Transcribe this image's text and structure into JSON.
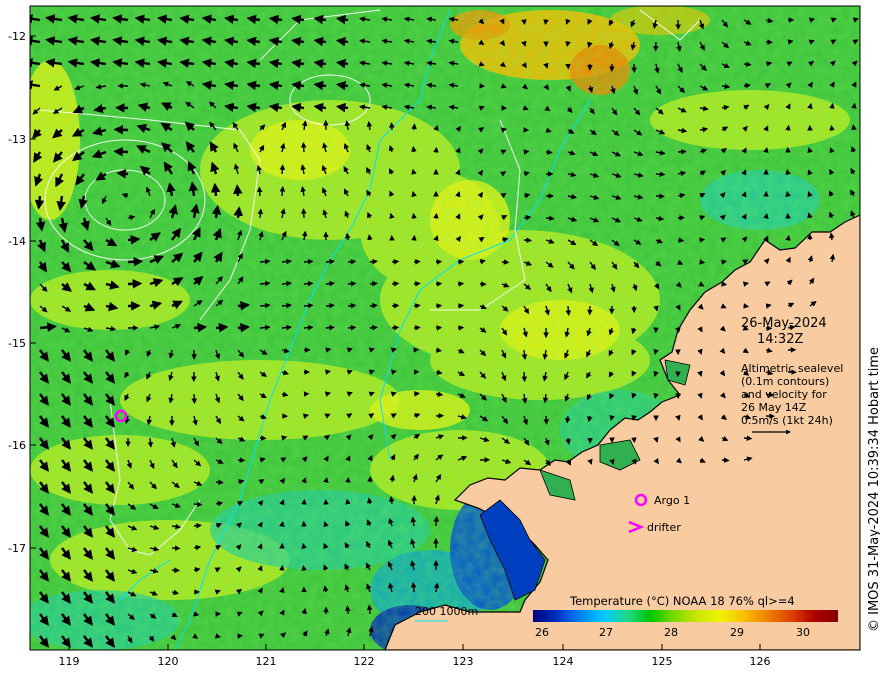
{
  "map": {
    "lon_ticks": [
      "119",
      "120",
      "121",
      "122",
      "123",
      "124",
      "125",
      "126"
    ],
    "lat_ticks": [
      "-12",
      "-13",
      "-14",
      "-15",
      "-16",
      "-17"
    ],
    "date": "26-May-2024",
    "time": "14:32Z",
    "legend_lines": [
      "Altimetric sealevel",
      "(0.1m contours)",
      "and velocity for",
      "26 May 14Z",
      "0.5m/s (1kt 24h)"
    ],
    "argo_label": "Argo 1",
    "drifter_label": "drifter",
    "isobath_label": "200  1000m",
    "colorbar": {
      "title": "Temperature (°C) NOAA 18 76% ql>=4",
      "ticks": [
        "26",
        "27",
        "28",
        "29",
        "30"
      ],
      "colors": [
        "#00007a",
        "#0030c0",
        "#0080ff",
        "#00c8ff",
        "#20d890",
        "#00c800",
        "#7ad800",
        "#c8e800",
        "#f0f000",
        "#f8c000",
        "#f08000",
        "#e04000",
        "#b00000",
        "#800000"
      ]
    },
    "credit": "© IMOS 31-May-2024 10:39:34 Hobart time",
    "colors": {
      "land": "#f8cca0",
      "ocean_base": "#38c038",
      "coast_ocean": "#30a050",
      "argo": "#ff00ff",
      "isobath": "#00e0ff",
      "contour": "#ffffff",
      "arrow": "#000000"
    }
  }
}
